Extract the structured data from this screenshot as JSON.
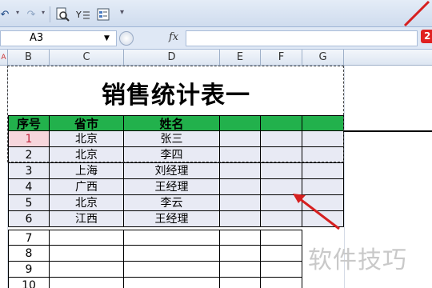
{
  "toolbar": {
    "items": [
      "undo",
      "redo",
      "print-preview",
      "filter",
      "form"
    ]
  },
  "formula_bar": {
    "cell_reference": "A3",
    "fx_label": "fx",
    "formula": ""
  },
  "badge": {
    "text": "2"
  },
  "columns": [
    "B",
    "C",
    "D",
    "E",
    "F",
    "G"
  ],
  "sheet": {
    "title": "销售统计表一",
    "header": [
      "序号",
      "省市",
      "姓名",
      "",
      "",
      ""
    ],
    "rows": [
      [
        "1",
        "北京",
        "张三"
      ],
      [
        "2",
        "北京",
        "李四"
      ],
      [
        "3",
        "上海",
        "刘经理"
      ],
      [
        "4",
        "广西",
        "王经理"
      ],
      [
        "5",
        "北京",
        "李云"
      ],
      [
        "6",
        "江西",
        "王经理"
      ],
      [
        "7",
        "",
        ""
      ],
      [
        "8",
        "",
        ""
      ],
      [
        "9",
        "",
        ""
      ],
      [
        "10",
        "",
        ""
      ]
    ]
  },
  "colors": {
    "header_fill": "#22b14c",
    "selection_fill": "#e8eaf4",
    "arrow": "#d62020"
  },
  "watermark": "软件技巧"
}
